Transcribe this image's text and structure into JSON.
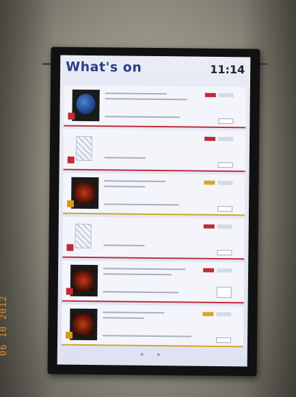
{
  "screen": {
    "title": "What's on",
    "clock": "11:14"
  },
  "photo": {
    "date_stamp": "06 10 2012"
  },
  "listings": [
    {
      "name": "",
      "thumbnail": "blue-portrait",
      "accent": "#c02a3a"
    },
    {
      "name": "",
      "thumbnail": "placeholder-qr",
      "accent": "#c02a3a"
    },
    {
      "name": "",
      "thumbnail": "red-stage",
      "accent": "#d4a12a"
    },
    {
      "name": "",
      "thumbnail": "placeholder-qr",
      "accent": "#c02a3a"
    },
    {
      "name": "",
      "thumbnail": "red-stage",
      "accent": "#c02a3a"
    },
    {
      "name": "",
      "thumbnail": "red-stage",
      "accent": "#d4a12a"
    }
  ],
  "colors": {
    "title_blue": "#2a3f86",
    "red_accent": "#c02a3a",
    "gold_accent": "#d4a12a",
    "date_stamp_orange": "#e98a2a"
  }
}
